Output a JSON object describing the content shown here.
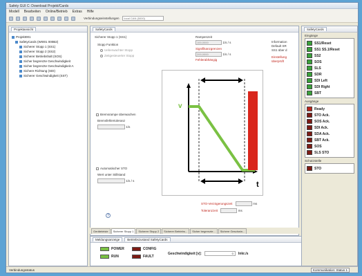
{
  "app": {
    "title": "Safety GUI C: Download Projekt/Cards"
  },
  "menu": [
    "Modell",
    "Bearbeiten",
    "Online/Betrieb",
    "Extras",
    "Hilfe"
  ],
  "toolbar": {
    "device_label": "Verbindungseinstellungen",
    "device_value": "local CAN (5000)"
  },
  "project": {
    "tab": "Projektansicht",
    "items": [
      "Projekt001",
      "SafetyCards (WI001 000B2)",
      "Sicherer Stopp 1 (SS1)",
      "Sicherer Stopp 2 (SS2)",
      "Sicherer Betriebshalt (SOS)",
      "Sicher begrenzte Geschwindigkeit",
      "Sicher begrenzte Geschwindigkeit-A",
      "Sichere Richtung (SDI)",
      "Sicherer Geschwindigkeit (SST)"
    ]
  },
  "editor": {
    "tab": "SafetyCards",
    "section": "Sicherer Stopp 1 (SS1)",
    "stop_function": "Stopp Funktion",
    "radio1": "Ueberwachter Stopp",
    "radio2": "Zeitgesteuerter Stopp",
    "ramp_label": "Rampenzeit",
    "ramp_value": "100,0000",
    "ramp_unit": "1/s / s",
    "red_label1": "Signifikanzgrenzen",
    "ramp2_value": "200,0000",
    "red_label2": "Fehlerabhängig",
    "info_title": "Information",
    "info_text1": "Default SR",
    "info_text2": "SS1 über d",
    "info_red1": "Einstellung",
    "info_red2": "überprüft",
    "brake_check": "Bremsrampe überwachen",
    "brake_field_label": "Bremsfehlertoleranz",
    "brake_unit": "1/s",
    "auto_check": "Automatischer STO",
    "auto_field_label": "Wert unter Stillstand",
    "auto_unit": "1/s / s",
    "sto_delay_label": "STO-Verzögerungszeit",
    "sto_delay_unit": "ms",
    "tol_label": "Toleranzzeit",
    "tol_unit": "ms",
    "help": "?",
    "v_label": "v",
    "t_label": "t"
  },
  "bottom_tabs": [
    "Geräteleiste",
    "Sicherer Stopp 1",
    "Sicherer Stopp 2",
    "Sicherer Betriebs...",
    "Sicher begrenzte...",
    "Sichere Geschwin..."
  ],
  "status_panel": {
    "tab1": "Meldungsanzeige",
    "tab2": "Betriebszustand SafetyCards",
    "power": "POWER",
    "config": "CONFIG",
    "run": "RUN",
    "fault": "FAULT",
    "speed_label": "Geschwindigkeit [v]:",
    "speed_value": "0",
    "speed_unit": "Inkr./s"
  },
  "lamps": {
    "tab": "SafetyCards",
    "ausgaenge_title": "Eingänge",
    "inputs": [
      "SS1/Reset",
      "SS1 SS.1/Reset",
      "SS2",
      "SOS",
      "SLS",
      "SDR",
      "SDI Left",
      "SDI Right",
      "SBT"
    ],
    "outputs_title": "Ausgänge",
    "outputs": [
      "Ready",
      "STO Ack.",
      "SOS Ack.",
      "SDI Ack.",
      "SDA Ack.",
      "SBT Ack.",
      "SOS",
      "SLS STO"
    ],
    "zentrale_title": "Schutzstelle",
    "zentrale": [
      "STO"
    ],
    "colors": {
      "green": "#3aa23a",
      "darkred": "#7d1b14",
      "red": "#b8241a"
    }
  },
  "statusbar": {
    "left": "Verbindungsstatus",
    "right": "Kommunikation: Status 1"
  }
}
